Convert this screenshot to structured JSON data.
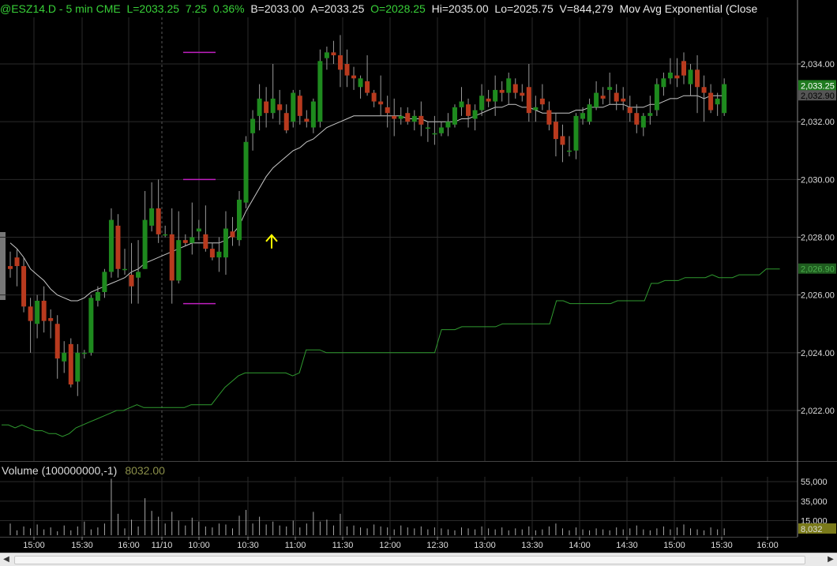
{
  "header": {
    "symbol": "@ESZ14.D - 5 min  CME",
    "last": "L=2033.25",
    "change": "7.25",
    "change_pct": "0.36%",
    "bid": "B=2033.00",
    "ask": "A=2033.25",
    "open": "O=2028.25",
    "high": "Hi=2035.00",
    "low": "Lo=2025.75",
    "volume": "V=844,279",
    "study": "Mov Avg Exponential (Close"
  },
  "volume_title": {
    "label": "Volume (100000000,-1)",
    "value": "8032.00"
  },
  "colors": {
    "up": "#1e8a1e",
    "down": "#b83a1e",
    "ma": "#c9c9c9",
    "slow_line": "#2f9a2f",
    "grid": "#2a2a2a",
    "marker": "#c01fc0",
    "arrow": "#ffff00"
  },
  "chart_data": [
    {
      "type": "candlestick",
      "title": "@ESZ14.D - 5 min",
      "x_tick_labels": [
        "15:00",
        "15:30",
        "16:00",
        "11/10",
        "10:00",
        "10:30",
        "11:00",
        "11:30",
        "12:00",
        "12:30",
        "13:00",
        "13:30",
        "14:00",
        "14:30",
        "15:00",
        "15:30",
        "16:00"
      ],
      "y_tick_labels": [
        "2,034.00",
        "2,032.00",
        "2,030.00",
        "2,028.00",
        "2,026.00",
        "2,024.00",
        "2,022.00"
      ],
      "ylim": [
        2020.7,
        2035.6
      ],
      "price_labels": {
        "last": "2,033.25",
        "moving_average": "2,032.90",
        "slow_line": "2,026.90"
      },
      "candles": [
        [
          2027.0,
          2027.5,
          2026.6,
          2026.9
        ],
        [
          2027.3,
          2027.6,
          2026.3,
          2027.0
        ],
        [
          2027.0,
          2027.3,
          2025.4,
          2025.6
        ],
        [
          2025.6,
          2025.9,
          2024.0,
          2025.1
        ],
        [
          2025.0,
          2026.0,
          2024.5,
          2025.8
        ],
        [
          2025.8,
          2026.3,
          2024.7,
          2025.1
        ],
        [
          2025.2,
          2025.5,
          2024.5,
          2025.1
        ],
        [
          2025.0,
          2025.3,
          2023.1,
          2023.8
        ],
        [
          2023.7,
          2024.4,
          2023.3,
          2024.0
        ],
        [
          2024.3,
          2024.5,
          2022.8,
          2022.9
        ],
        [
          2023.0,
          2024.3,
          2022.5,
          2024.0
        ],
        [
          2024.0,
          2024.1,
          2023.8,
          2024.0
        ],
        [
          2024.0,
          2026.0,
          2023.9,
          2025.9
        ],
        [
          2025.8,
          2026.3,
          2025.6,
          2026.1
        ],
        [
          2026.1,
          2026.9,
          2025.9,
          2026.8
        ],
        [
          2026.8,
          2029.0,
          2026.6,
          2028.6
        ],
        [
          2028.4,
          2028.8,
          2026.6,
          2026.9
        ],
        [
          2026.9,
          2027.6,
          2026.7,
          2026.9
        ],
        [
          2026.7,
          2027.8,
          2025.7,
          2026.3
        ],
        [
          2026.6,
          2027.9,
          2025.7,
          2026.8
        ],
        [
          2026.9,
          2029.6,
          2026.9,
          2028.6
        ],
        [
          2028.4,
          2029.9,
          2028.2,
          2029.0
        ],
        [
          2029.0,
          2030.0,
          2027.8,
          2028.1
        ],
        [
          2028.1,
          2028.4,
          2028.0,
          2028.1
        ],
        [
          2028.1,
          2029.0,
          2025.7,
          2026.5
        ],
        [
          2026.5,
          2028.9,
          2026.4,
          2027.9
        ],
        [
          2027.9,
          2028.1,
          2027.7,
          2027.8
        ],
        [
          2027.8,
          2029.2,
          2027.4,
          2028.0
        ],
        [
          2028.2,
          2028.6,
          2027.9,
          2028.3
        ],
        [
          2028.1,
          2029.1,
          2027.5,
          2027.6
        ],
        [
          2027.6,
          2027.8,
          2027.2,
          2027.3
        ],
        [
          2027.3,
          2028.0,
          2026.8,
          2027.5
        ],
        [
          2027.3,
          2028.9,
          2026.7,
          2028.3
        ],
        [
          2028.2,
          2028.7,
          2027.7,
          2028.0
        ],
        [
          2027.9,
          2029.6,
          2027.7,
          2029.3
        ],
        [
          2029.2,
          2031.5,
          2029.0,
          2031.3
        ],
        [
          2031.6,
          2032.4,
          2031.0,
          2032.1
        ],
        [
          2032.2,
          2033.3,
          2031.7,
          2032.8
        ],
        [
          2032.7,
          2033.2,
          2031.8,
          2032.3
        ],
        [
          2032.3,
          2034.0,
          2032.1,
          2032.8
        ],
        [
          2032.6,
          2033.1,
          2031.9,
          2032.4
        ],
        [
          2032.3,
          2032.6,
          2031.6,
          2031.7
        ],
        [
          2032.0,
          2033.1,
          2031.8,
          2033.0
        ],
        [
          2032.9,
          2033.1,
          2031.9,
          2032.2
        ],
        [
          2032.1,
          2032.4,
          2031.8,
          2032.0
        ],
        [
          2031.8,
          2032.8,
          2031.6,
          2032.7
        ],
        [
          2032.0,
          2034.5,
          2031.8,
          2034.1
        ],
        [
          2034.2,
          2034.6,
          2033.8,
          2034.4
        ],
        [
          2034.4,
          2034.8,
          2034.0,
          2034.3
        ],
        [
          2034.3,
          2035.0,
          2033.2,
          2033.8
        ],
        [
          2034.0,
          2034.5,
          2033.2,
          2033.6
        ],
        [
          2033.6,
          2033.9,
          2033.1,
          2033.5
        ],
        [
          2033.2,
          2033.6,
          2032.8,
          2033.5
        ],
        [
          2033.4,
          2034.3,
          2032.9,
          2033.0
        ],
        [
          2033.0,
          2033.1,
          2032.5,
          2032.7
        ],
        [
          2032.7,
          2033.6,
          2032.2,
          2032.6
        ],
        [
          2032.5,
          2032.9,
          2031.8,
          2032.3
        ],
        [
          2032.2,
          2032.8,
          2031.5,
          2032.1
        ],
        [
          2032.1,
          2032.5,
          2031.9,
          2032.2
        ],
        [
          2032.3,
          2032.5,
          2031.9,
          2032.0
        ],
        [
          2032.0,
          2032.4,
          2031.7,
          2032.2
        ],
        [
          2032.2,
          2032.7,
          2031.5,
          2031.9
        ],
        [
          2031.8,
          2032.0,
          2031.3,
          2031.8
        ],
        [
          2031.6,
          2032.2,
          2031.2,
          2031.6
        ],
        [
          2031.6,
          2032.0,
          2031.5,
          2031.8
        ],
        [
          2031.8,
          2032.3,
          2031.5,
          2032.0
        ],
        [
          2031.9,
          2032.6,
          2031.8,
          2032.5
        ],
        [
          2032.5,
          2033.2,
          2032.2,
          2032.7
        ],
        [
          2032.6,
          2032.8,
          2031.8,
          2032.2
        ],
        [
          2032.1,
          2032.6,
          2031.7,
          2032.4
        ],
        [
          2032.4,
          2033.3,
          2032.2,
          2032.9
        ],
        [
          2032.8,
          2033.1,
          2032.5,
          2032.7
        ],
        [
          2032.7,
          2033.6,
          2032.2,
          2033.1
        ],
        [
          2033.1,
          2033.4,
          2032.7,
          2033.0
        ],
        [
          2033.0,
          2033.7,
          2032.6,
          2033.5
        ],
        [
          2033.3,
          2033.5,
          2032.8,
          2033.0
        ],
        [
          2033.0,
          2033.3,
          2032.7,
          2032.9
        ],
        [
          2033.2,
          2034.0,
          2032.0,
          2032.3
        ],
        [
          2032.4,
          2032.9,
          2032.0,
          2032.5
        ],
        [
          2032.8,
          2033.3,
          2032.4,
          2032.6
        ],
        [
          2032.4,
          2032.7,
          2031.7,
          2031.9
        ],
        [
          2032.0,
          2032.3,
          2030.8,
          2031.4
        ],
        [
          2031.5,
          2031.9,
          2030.6,
          2031.2
        ],
        [
          2031.0,
          2031.5,
          2030.8,
          2031.0
        ],
        [
          2031.0,
          2032.3,
          2030.7,
          2032.2
        ],
        [
          2032.1,
          2032.5,
          2031.9,
          2032.3
        ],
        [
          2032.0,
          2032.8,
          2031.9,
          2032.6
        ],
        [
          2032.5,
          2033.4,
          2032.4,
          2033.0
        ],
        [
          2032.9,
          2033.2,
          2032.6,
          2032.8
        ],
        [
          2033.1,
          2033.7,
          2032.6,
          2033.2
        ],
        [
          2033.0,
          2033.3,
          2032.4,
          2032.7
        ],
        [
          2032.8,
          2033.2,
          2032.4,
          2032.7
        ],
        [
          2032.5,
          2032.9,
          2032.0,
          2032.3
        ],
        [
          2032.3,
          2032.6,
          2031.6,
          2031.9
        ],
        [
          2031.8,
          2032.3,
          2031.5,
          2032.2
        ],
        [
          2032.2,
          2032.9,
          2031.9,
          2032.3
        ],
        [
          2032.4,
          2033.5,
          2032.2,
          2033.3
        ],
        [
          2033.2,
          2033.7,
          2032.9,
          2033.5
        ],
        [
          2033.5,
          2034.2,
          2033.3,
          2033.7
        ],
        [
          2033.6,
          2034.2,
          2033.2,
          2033.5
        ],
        [
          2034.1,
          2034.4,
          2033.3,
          2033.6
        ],
        [
          2033.3,
          2034.0,
          2032.9,
          2033.8
        ],
        [
          2033.8,
          2034.3,
          2032.3,
          2033.2
        ],
        [
          2033.2,
          2033.6,
          2032.0,
          2033.0
        ],
        [
          2033.0,
          2033.3,
          2032.3,
          2032.4
        ],
        [
          2032.6,
          2033.0,
          2032.2,
          2032.8
        ],
        [
          2032.3,
          2033.5,
          2032.2,
          2033.3
        ]
      ],
      "moving_average": [
        2027.8,
        2027.6,
        2027.3,
        2026.9,
        2026.7,
        2026.5,
        2026.2,
        2026.0,
        2025.9,
        2025.8,
        2025.8,
        2025.9,
        2026.1,
        2026.2,
        2026.3,
        2026.4,
        2026.5,
        2026.6,
        2026.8,
        2026.9,
        2027.1,
        2027.2,
        2027.3,
        2027.4,
        2027.5,
        2027.6,
        2027.7,
        2027.8,
        2027.8,
        2027.8,
        2027.8,
        2027.8,
        2027.9,
        2028.1,
        2028.4,
        2028.9,
        2029.3,
        2029.7,
        2030.1,
        2030.4,
        2030.6,
        2030.8,
        2031.0,
        2031.1,
        2031.3,
        2031.4,
        2031.6,
        2031.8,
        2031.9,
        2032.0,
        2032.1,
        2032.2,
        2032.2,
        2032.2,
        2032.2,
        2032.2,
        2032.2,
        2032.2,
        2032.2,
        2032.1,
        2032.1,
        2032.1,
        2032.0,
        2032.0,
        2032.0,
        2032.0,
        2032.0,
        2032.1,
        2032.1,
        2032.2,
        2032.3,
        2032.4,
        2032.5,
        2032.5,
        2032.6,
        2032.6,
        2032.5,
        2032.5,
        2032.4,
        2032.3,
        2032.3,
        2032.3,
        2032.3,
        2032.3,
        2032.4,
        2032.4,
        2032.5,
        2032.5,
        2032.5,
        2032.6,
        2032.6,
        2032.6,
        2032.5,
        2032.5,
        2032.5,
        2032.6,
        2032.6,
        2032.7,
        2032.8,
        2032.8,
        2032.9,
        2032.9,
        2032.9,
        2032.8,
        2032.9,
        2032.9,
        2032.9
      ],
      "slow_line": [
        2021.5,
        2021.5,
        2021.4,
        2021.5,
        2021.4,
        2021.3,
        2021.3,
        2021.2,
        2021.2,
        2021.1,
        2021.2,
        2021.4,
        2021.5,
        2021.6,
        2021.7,
        2021.8,
        2021.9,
        2022.0,
        2022.0,
        2022.1,
        2022.2,
        2022.1,
        2022.1,
        2022.1,
        2022.1,
        2022.1,
        2022.1,
        2022.1,
        2022.2,
        2022.2,
        2022.2,
        2022.2,
        2022.5,
        2022.8,
        2023.0,
        2023.2,
        2023.3,
        2023.3,
        2023.3,
        2023.3,
        2023.3,
        2023.3,
        2023.3,
        2023.2,
        2023.3,
        2024.1,
        2024.1,
        2024.1,
        2024.0,
        2024.0,
        2024.0,
        2024.0,
        2024.0,
        2024.0,
        2024.0,
        2024.0,
        2024.0,
        2024.0,
        2024.0,
        2024.0,
        2024.0,
        2024.0,
        2024.0,
        2024.0,
        2024.0,
        2024.8,
        2024.8,
        2024.8,
        2024.9,
        2024.9,
        2024.9,
        2024.9,
        2024.9,
        2024.9,
        2025.0,
        2025.0,
        2025.0,
        2025.0,
        2025.0,
        2025.0,
        2025.0,
        2025.0,
        2025.8,
        2025.8,
        2025.7,
        2025.7,
        2025.7,
        2025.7,
        2025.7,
        2025.7,
        2025.7,
        2025.8,
        2025.8,
        2025.8,
        2025.8,
        2025.8,
        2026.4,
        2026.4,
        2026.5,
        2026.5,
        2026.5,
        2026.6,
        2026.6,
        2026.6,
        2026.6,
        2026.7,
        2026.6,
        2026.6,
        2026.6,
        2026.7,
        2026.7,
        2026.7,
        2026.7,
        2026.9,
        2026.9,
        2026.9
      ],
      "markers": [
        {
          "value": 2034.4,
          "type": "high"
        },
        {
          "value": 2030.0,
          "type": "level"
        },
        {
          "value": 2025.7,
          "type": "low"
        }
      ],
      "signal_arrow": {
        "direction": "up",
        "at": 2027.5
      }
    },
    {
      "type": "bar",
      "title": "Volume (100000000,-1)",
      "y_tick_labels": [
        "55,000",
        "35,000",
        "15,000"
      ],
      "ylim": [
        0,
        60000
      ],
      "last_label": "8,032",
      "values": [
        12000,
        5000,
        9000,
        7000,
        11000,
        6000,
        8000,
        4000,
        10000,
        5000,
        9000,
        14000,
        6000,
        8000,
        12000,
        58000,
        22000,
        7000,
        16000,
        9000,
        38000,
        25000,
        19000,
        12000,
        24000,
        15000,
        10000,
        18000,
        14000,
        9000,
        8000,
        12000,
        11000,
        7000,
        20000,
        26000,
        12000,
        19000,
        11000,
        14000,
        10000,
        9000,
        15000,
        8000,
        12000,
        24000,
        14000,
        16000,
        10000,
        22000,
        9000,
        10000,
        8000,
        7000,
        11000,
        9000,
        8000,
        6000,
        10000,
        8000,
        7000,
        9000,
        6000,
        8000,
        7000,
        6000,
        5000,
        8000,
        7000,
        6000,
        9000,
        7000,
        6000,
        8000,
        5000,
        7000,
        6000,
        9000,
        5000,
        6000,
        9000,
        12000,
        7000,
        5000,
        8000,
        6000,
        5000,
        7000,
        6000,
        5000,
        8000,
        6000,
        7000,
        10000,
        6000,
        5000,
        7000,
        9000,
        6000,
        8000,
        11000,
        7000,
        6000,
        5000,
        8000,
        6000,
        7000
      ]
    }
  ]
}
